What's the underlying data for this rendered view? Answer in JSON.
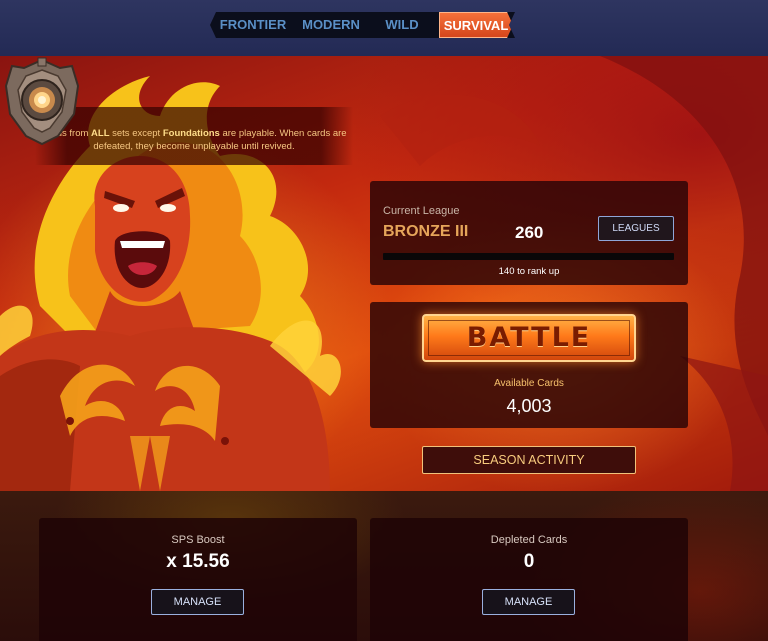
{
  "nav": {
    "tabs": [
      {
        "label": "FRONTIER",
        "active": false
      },
      {
        "label": "MODERN",
        "active": false
      },
      {
        "label": "WILD",
        "active": false
      },
      {
        "label": "SURVIVAL",
        "active": true
      }
    ]
  },
  "rules": {
    "prefix": "Cards from ",
    "all": "ALL",
    "middle": " sets except ",
    "foundations": "Foundations",
    "suffix": " are playable. When cards are defeated, they become unplayable until revived."
  },
  "league": {
    "caption": "Current League",
    "name": "BRONZE III",
    "points": "260",
    "leagues_button": "LEAGUES",
    "rank_progress": 0.0,
    "rank_text": "140 to rank up",
    "emblem_icon": "bronze-league-shield-icon"
  },
  "battle": {
    "button_label": "BATTLE",
    "available_caption": "Available Cards",
    "available_value": "4,003"
  },
  "season_button": "SEASON ACTIVITY",
  "sps": {
    "caption": "SPS Boost",
    "value": "x 15.56",
    "button": "MANAGE"
  },
  "depleted": {
    "caption": "Depleted Cards",
    "value": "0",
    "button": "MANAGE"
  },
  "colors": {
    "active_tab": "#e5561f",
    "league_name": "#e5a55a",
    "battle_button": "#ff7a1a"
  }
}
